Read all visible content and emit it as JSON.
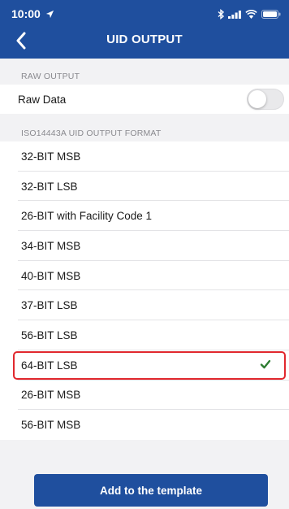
{
  "status_bar": {
    "time": "10:00",
    "icons": [
      "location-arrow-icon",
      "bluetooth-icon",
      "signal-icon",
      "wifi-icon",
      "battery-icon"
    ]
  },
  "nav": {
    "title": "UID OUTPUT",
    "back_icon": "chevron-left-icon"
  },
  "raw_section": {
    "header": "RAW OUTPUT",
    "raw_data_label": "Raw Data",
    "raw_data_enabled": false
  },
  "format_section": {
    "header": "ISO14443A UID OUTPUT FORMAT",
    "options": [
      {
        "label": "32-BIT MSB",
        "selected": false
      },
      {
        "label": "32-BIT LSB",
        "selected": false
      },
      {
        "label": "26-BIT with Facility Code 1",
        "selected": false
      },
      {
        "label": "34-BIT MSB",
        "selected": false
      },
      {
        "label": "40-BIT MSB",
        "selected": false
      },
      {
        "label": "37-BIT LSB",
        "selected": false
      },
      {
        "label": "56-BIT LSB",
        "selected": false
      },
      {
        "label": "64-BIT LSB",
        "selected": true
      },
      {
        "label": "26-BIT MSB",
        "selected": false
      },
      {
        "label": "56-BIT MSB",
        "selected": false
      }
    ]
  },
  "footer": {
    "add_button_label": "Add to the template"
  },
  "colors": {
    "brand_blue": "#1f4f9e",
    "selection_red": "#e1282e",
    "check_green": "#2e7d32"
  }
}
